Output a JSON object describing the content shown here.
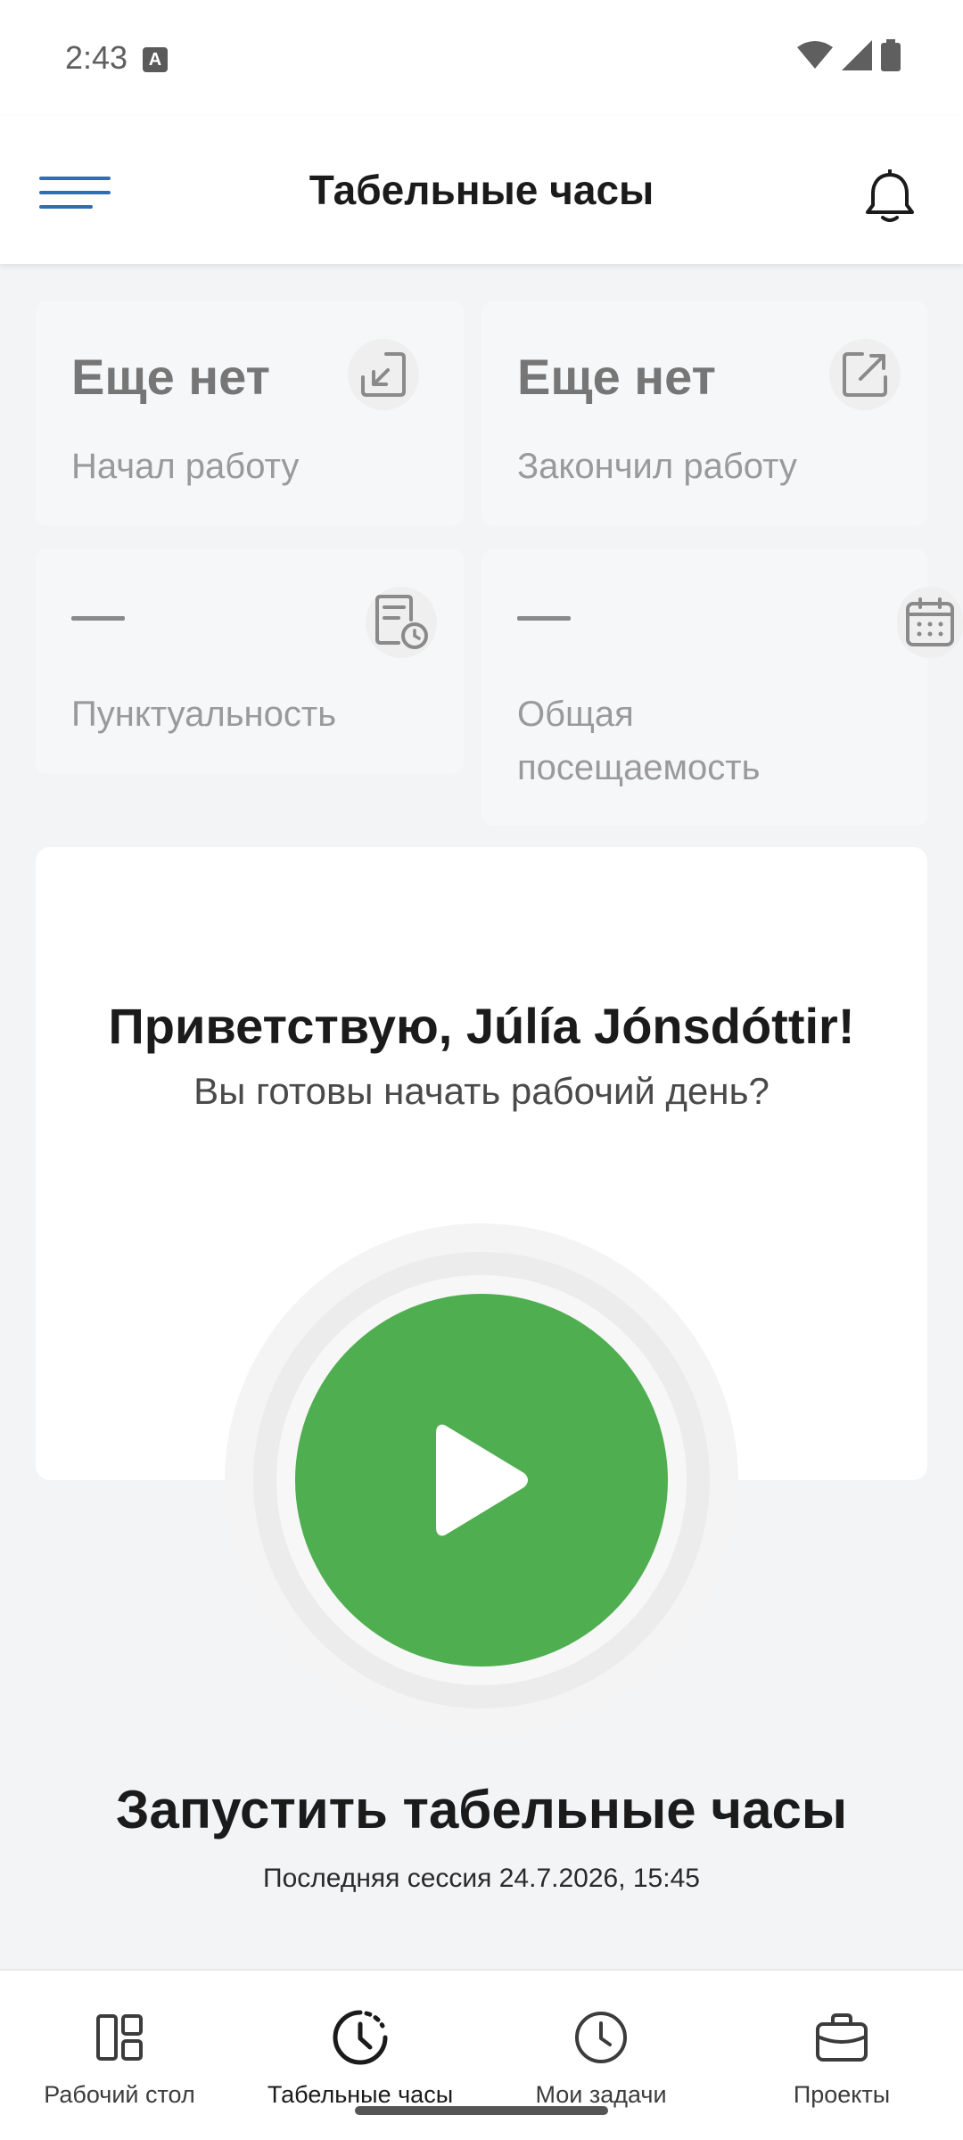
{
  "status_bar": {
    "time": "2:43",
    "notification_glyph": "A"
  },
  "header": {
    "title": "Табельные часы"
  },
  "stats": {
    "started": {
      "value": "Еще нет",
      "label": "Начал работу"
    },
    "finished": {
      "value": "Еще нет",
      "label": "Закончил работу"
    },
    "punctuality": {
      "value": "—",
      "label": "Пунктуальность"
    },
    "attendance": {
      "value": "—",
      "label_line1": "Общая",
      "label_line2": "посещаемость"
    }
  },
  "greeting": {
    "title": "Приветствую, Júlía Jónsdóttir!",
    "subtitle": "Вы готовы начать рабочий день?"
  },
  "clock": {
    "start_label": "Запустить табельные часы",
    "last_session": "Последняя сессия 24.7.2026, 15:45"
  },
  "bottom_nav": {
    "items": [
      {
        "label": "Рабочий стол",
        "icon": "dashboard-icon",
        "active": false
      },
      {
        "label": "Табельные часы",
        "icon": "clock-arrow-icon",
        "active": true
      },
      {
        "label": "Мои задачи",
        "icon": "clock-icon",
        "active": false
      },
      {
        "label": "Проекты",
        "icon": "briefcase-icon",
        "active": false
      }
    ]
  },
  "colors": {
    "accent_blue": "#2f6db5",
    "start_green": "#4fae50"
  }
}
